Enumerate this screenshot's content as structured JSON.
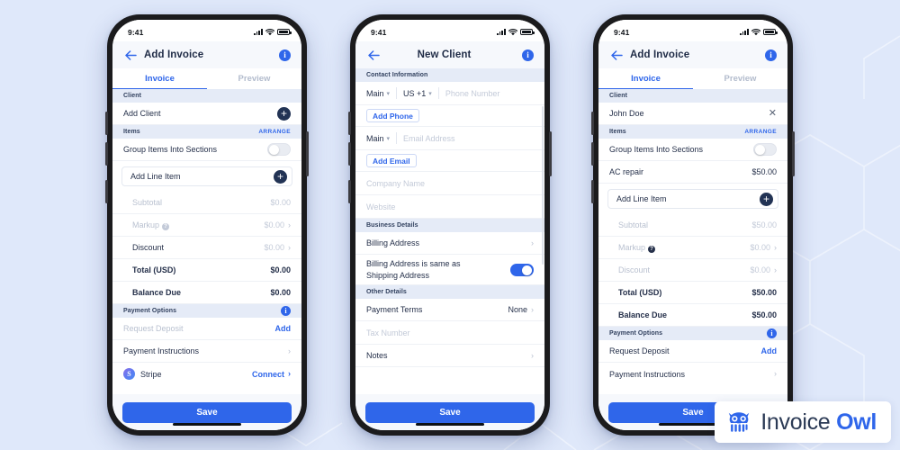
{
  "background": {
    "color": "#dfe8fa",
    "pattern": "hexagon-outline-lines"
  },
  "status_bar": {
    "time": "9:41",
    "signal": "signal-icon",
    "wifi": "wifi-icon",
    "battery": "battery-icon"
  },
  "phones": [
    {
      "id": "phone-add-invoice-empty",
      "nav": {
        "title": "Add Invoice",
        "back": "back-arrow-icon",
        "info": "i"
      },
      "tabs": [
        {
          "label": "Invoice",
          "active": true
        },
        {
          "label": "Preview",
          "active": false
        }
      ],
      "sections": [
        {
          "header": "Client",
          "action": ""
        },
        {
          "header": "Items",
          "action": "ARRANGE"
        },
        {
          "header": "Payment Options",
          "action": "info"
        }
      ],
      "rows": {
        "add_client": {
          "label": "Add Client",
          "icon": "plus-icon"
        },
        "group_items": {
          "label": "Group Items Into Sections",
          "toggle": false
        },
        "add_line_item": {
          "label": "Add Line Item",
          "icon": "plus-icon"
        },
        "subtotal": {
          "label": "Subtotal",
          "value": "$0.00"
        },
        "markup": {
          "label": "Markup",
          "value": "$0.00"
        },
        "discount": {
          "label": "Discount",
          "value": "$0.00"
        },
        "total": {
          "label": "Total (USD)",
          "value": "$0.00"
        },
        "balance_due": {
          "label": "Balance Due",
          "value": "$0.00"
        },
        "request_deposit": {
          "label": "Request Deposit",
          "value": "Add"
        },
        "payment_instructions": {
          "label": "Payment Instructions",
          "value": ""
        },
        "stripe": {
          "label": "Stripe",
          "value": "Connect"
        }
      },
      "save_label": "Save"
    },
    {
      "id": "phone-new-client",
      "nav": {
        "title": "New Client",
        "back": "back-arrow-icon",
        "info": "i"
      },
      "sections": [
        {
          "header": "Contact Information"
        },
        {
          "header": "Business Details"
        },
        {
          "header": "Other Details"
        }
      ],
      "rows": {
        "phone": {
          "type_label": "Main",
          "country": "US  +1",
          "placeholder": "Phone Number"
        },
        "add_phone": {
          "label": "Add Phone"
        },
        "email": {
          "type_label": "Main",
          "placeholder": "Email Address"
        },
        "add_email": {
          "label": "Add Email"
        },
        "company": {
          "placeholder": "Company Name"
        },
        "website": {
          "placeholder": "Website"
        },
        "billing_address": {
          "label": "Billing Address"
        },
        "same_as_shipping": {
          "label": "Billing Address is same as Shipping Address",
          "toggle": true
        },
        "payment_terms": {
          "label": "Payment Terms",
          "value": "None"
        },
        "tax_number": {
          "placeholder": "Tax Number"
        },
        "notes": {
          "label": "Notes"
        }
      },
      "save_label": "Save"
    },
    {
      "id": "phone-add-invoice-filled",
      "nav": {
        "title": "Add Invoice",
        "back": "back-arrow-icon",
        "info": "i"
      },
      "tabs": [
        {
          "label": "Invoice",
          "active": true
        },
        {
          "label": "Preview",
          "active": false
        }
      ],
      "sections": [
        {
          "header": "Client",
          "action": ""
        },
        {
          "header": "Items",
          "action": "ARRANGE"
        },
        {
          "header": "Payment Options",
          "action": "info"
        }
      ],
      "rows": {
        "client": {
          "label": "John Doe",
          "icon": "close-icon"
        },
        "group_items": {
          "label": "Group Items Into Sections",
          "toggle": false
        },
        "line_item": {
          "label": "AC repair",
          "value": "$50.00"
        },
        "add_line_item": {
          "label": "Add Line Item",
          "icon": "plus-icon"
        },
        "subtotal": {
          "label": "Subtotal",
          "value": "$50.00"
        },
        "markup": {
          "label": "Markup",
          "value": "$0.00"
        },
        "discount": {
          "label": "Discount",
          "value": "$0.00"
        },
        "total": {
          "label": "Total (USD)",
          "value": "$50.00"
        },
        "balance_due": {
          "label": "Balance Due",
          "value": "$50.00"
        },
        "request_deposit": {
          "label": "Request Deposit",
          "value": "Add"
        },
        "payment_instructions": {
          "label": "Payment Instructions",
          "value": ""
        }
      },
      "save_label": "Save"
    }
  ],
  "logo": {
    "word1": "Invoice",
    "word2": "Owl",
    "icon": "owl-icon",
    "accent": "#2f66ea"
  }
}
